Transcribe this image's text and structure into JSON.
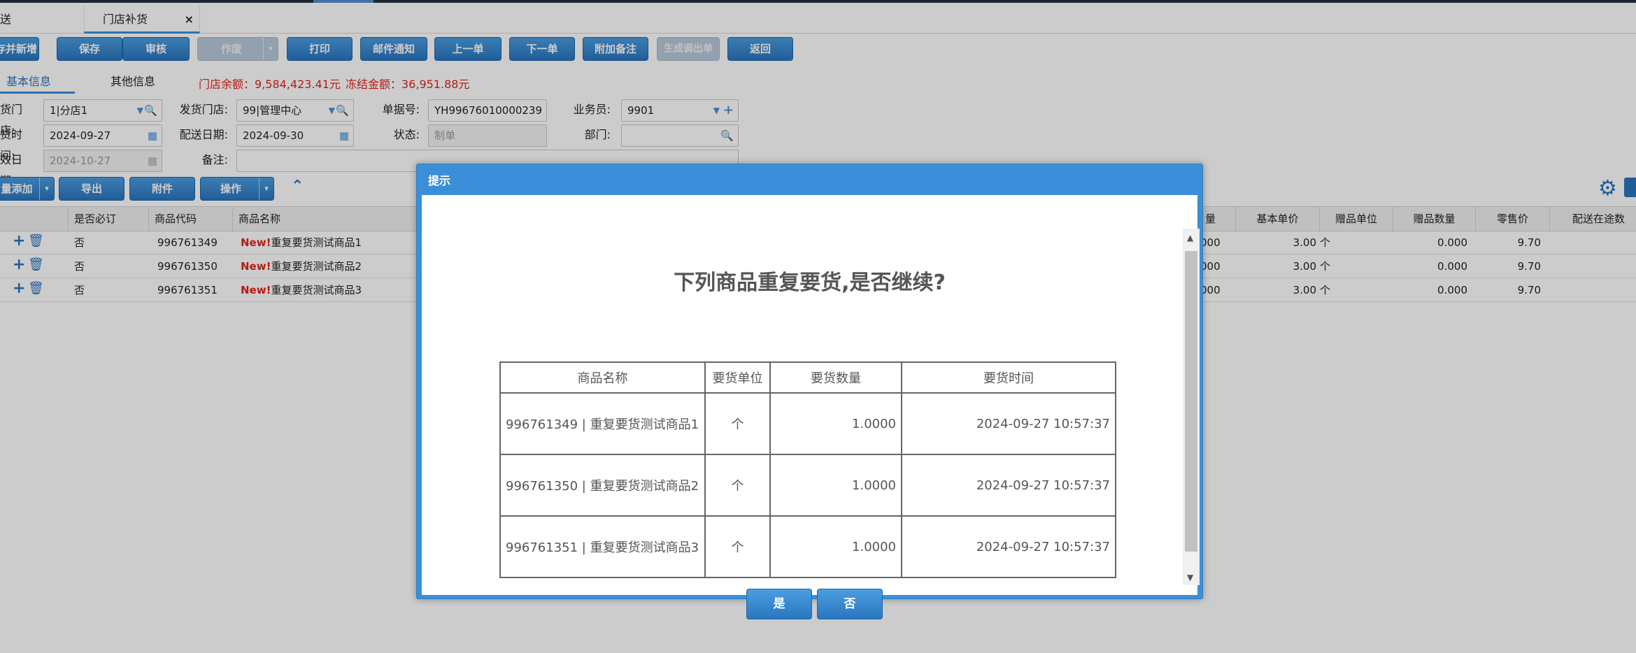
{
  "tabs": [
    {
      "label": "送"
    },
    {
      "label": "门店补货",
      "close": "×"
    }
  ],
  "toolbar": {
    "buttons": [
      "存并新增",
      "保存",
      "审核",
      "作废",
      "打印",
      "邮件通知",
      "上一单",
      "下一单",
      "附加备注",
      "生成调出单",
      "返回"
    ],
    "dropdown_glyph": "▾"
  },
  "subtabs": {
    "basic": "基本信息",
    "other": "其他信息"
  },
  "balances": {
    "store_balance": "门店余额：9,584,423.41元",
    "frozen_amount": "冻结金额：36,951.88元"
  },
  "form": {
    "recv_store_label": "货门店:",
    "recv_store_value": "1|分店1",
    "send_store_label": "发货门店:",
    "send_store_value": "99|管理中心",
    "doc_no_label": "单据号:",
    "doc_no_value": "YH99676010000239",
    "salesman_label": "业务员:",
    "salesman_value": "9901",
    "order_time_label": "货时间:",
    "order_time_value": "2024-09-27",
    "delivery_date_label": "配送日期:",
    "delivery_date_value": "2024-09-30",
    "status_label": "状态:",
    "status_value": "制单",
    "dept_label": "部门:",
    "dept_value": "",
    "expire_date_label": "效日期:",
    "expire_date_value": "2024-10-27",
    "remark_label": "备注:",
    "remark_value": ""
  },
  "grid_toolbar": {
    "batch_add": "量添加",
    "export": "导出",
    "attachment": "附件",
    "operate": "操作"
  },
  "grid": {
    "headers_left": [
      "是否必订",
      "商品代码",
      "商品名称"
    ],
    "headers_right": [
      "量",
      "基本单价",
      "赠品单位",
      "赠品数量",
      "零售价",
      "配送在途数"
    ],
    "new_tag": "New!",
    "rows": [
      {
        "required": "否",
        "code": "996761349",
        "name": "重复要货测试商品1",
        "qty": "000",
        "price": "3.00",
        "gift_unit": "个",
        "gift_qty": "0.000",
        "retail": "9.70"
      },
      {
        "required": "否",
        "code": "996761350",
        "name": "重复要货测试商品2",
        "qty": "000",
        "price": "3.00",
        "gift_unit": "个",
        "gift_qty": "0.000",
        "retail": "9.70"
      },
      {
        "required": "否",
        "code": "996761351",
        "name": "重复要货测试商品3",
        "qty": "000",
        "price": "3.00",
        "gift_unit": "个",
        "gift_qty": "0.000",
        "retail": "9.70"
      }
    ]
  },
  "modal": {
    "title": "提示",
    "message": "下列商品重复要货,是否继续?",
    "table_headers": [
      "商品名称",
      "要货单位",
      "要货数量",
      "要货时间"
    ],
    "rows": [
      {
        "name": "996761349 | 重复要货测试商品1",
        "unit": "个",
        "qty": "1.0000",
        "time": "2024-09-27 10:57:37"
      },
      {
        "name": "996761350 | 重复要货测试商品2",
        "unit": "个",
        "qty": "1.0000",
        "time": "2024-09-27 10:57:37"
      },
      {
        "name": "996761351 | 重复要货测试商品3",
        "unit": "个",
        "qty": "1.0000",
        "time": "2024-09-27 10:57:37"
      }
    ],
    "yes": "是",
    "no": "否"
  }
}
